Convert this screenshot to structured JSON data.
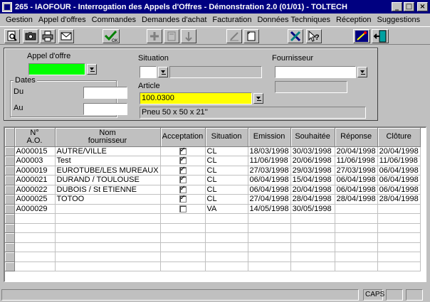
{
  "window": {
    "title": "265 - IAOFOUR - Interrogation des Appels d'Offres - Démonstration 2.0 (01/01) - TOLTECH",
    "min_label": "_",
    "max_label": "□",
    "close_label": "×"
  },
  "menu": [
    "Gestion",
    "Appel d'offres",
    "Commandes",
    "Demandes d'achat",
    "Facturation",
    "Données Techniques",
    "Réception",
    "Suggestions"
  ],
  "toolbar": {
    "icons": [
      "preview-icon",
      "camera-icon",
      "printer-icon",
      "mail-icon",
      "ok-check-icon",
      "add-icon",
      "delete-icon",
      "sort-icon",
      "edit-icon",
      "copy-icon",
      "tools-icon",
      "help-icon",
      "magic-wand-icon",
      "exit-door-icon"
    ],
    "ok_label": "OK"
  },
  "criteria": {
    "appel_label": "Appel d'offre",
    "appel_value": "",
    "dates_legend": "Dates",
    "du_label": "Du",
    "du_value": "",
    "au_label": "Au",
    "au_value": "",
    "situation_label": "Situation",
    "situation_value": "",
    "fournisseur_label": "Fournisseur",
    "fournisseur_value": "",
    "article_label": "Article",
    "article_value": "100.0300",
    "article_desc": "Pneu 50 x 50 x 21''",
    "colors": {
      "appel_bg": "#00ff00",
      "article_bg": "#ffff00"
    }
  },
  "grid": {
    "headers": {
      "no_line1": "N°",
      "no_line2": "A.O.",
      "nom_line1": "Nom",
      "nom_line2": "fournisseur",
      "acceptation": "Acceptation",
      "situation": "Situation",
      "emission": "Emission",
      "souhaitee": "Souhaitée",
      "reponse": "Réponse",
      "cloture": "Clôture"
    },
    "rows": [
      {
        "no": "A000015",
        "nom": "AUTRE/VILLE",
        "accepted": true,
        "situation": "CL",
        "emission": "18/03/1998",
        "souhaitee": "30/03/1998",
        "reponse": "20/04/1998",
        "cloture": "20/04/1998"
      },
      {
        "no": "A00003",
        "nom": "Test",
        "accepted": true,
        "situation": "CL",
        "emission": "11/06/1998",
        "souhaitee": "20/06/1998",
        "reponse": "11/06/1998",
        "cloture": "11/06/1998"
      },
      {
        "no": "A000019",
        "nom": "EUROTUBE/LES MUREAUX",
        "accepted": true,
        "situation": "CL",
        "emission": "27/03/1998",
        "souhaitee": "29/03/1998",
        "reponse": "27/03/1998",
        "cloture": "06/04/1998"
      },
      {
        "no": "A000021",
        "nom": "DURAND / TOULOUSE",
        "accepted": true,
        "situation": "CL",
        "emission": "06/04/1998",
        "souhaitee": "15/04/1998",
        "reponse": "06/04/1998",
        "cloture": "06/04/1998"
      },
      {
        "no": "A000022",
        "nom": "DUBOIS / St ETIENNE",
        "accepted": true,
        "situation": "CL",
        "emission": "06/04/1998",
        "souhaitee": "20/04/1998",
        "reponse": "06/04/1998",
        "cloture": "06/04/1998"
      },
      {
        "no": "A000025",
        "nom": "TOTOO",
        "accepted": true,
        "situation": "CL",
        "emission": "27/04/1998",
        "souhaitee": "28/04/1998",
        "reponse": "28/04/1998",
        "cloture": "28/04/1998"
      },
      {
        "no": "A000029",
        "nom": "",
        "accepted": false,
        "situation": "VA",
        "emission": "14/05/1998",
        "souhaitee": "30/05/1998",
        "reponse": "",
        "cloture": ""
      }
    ],
    "empty_rows": 6
  },
  "status": {
    "caps": "CAPS"
  }
}
